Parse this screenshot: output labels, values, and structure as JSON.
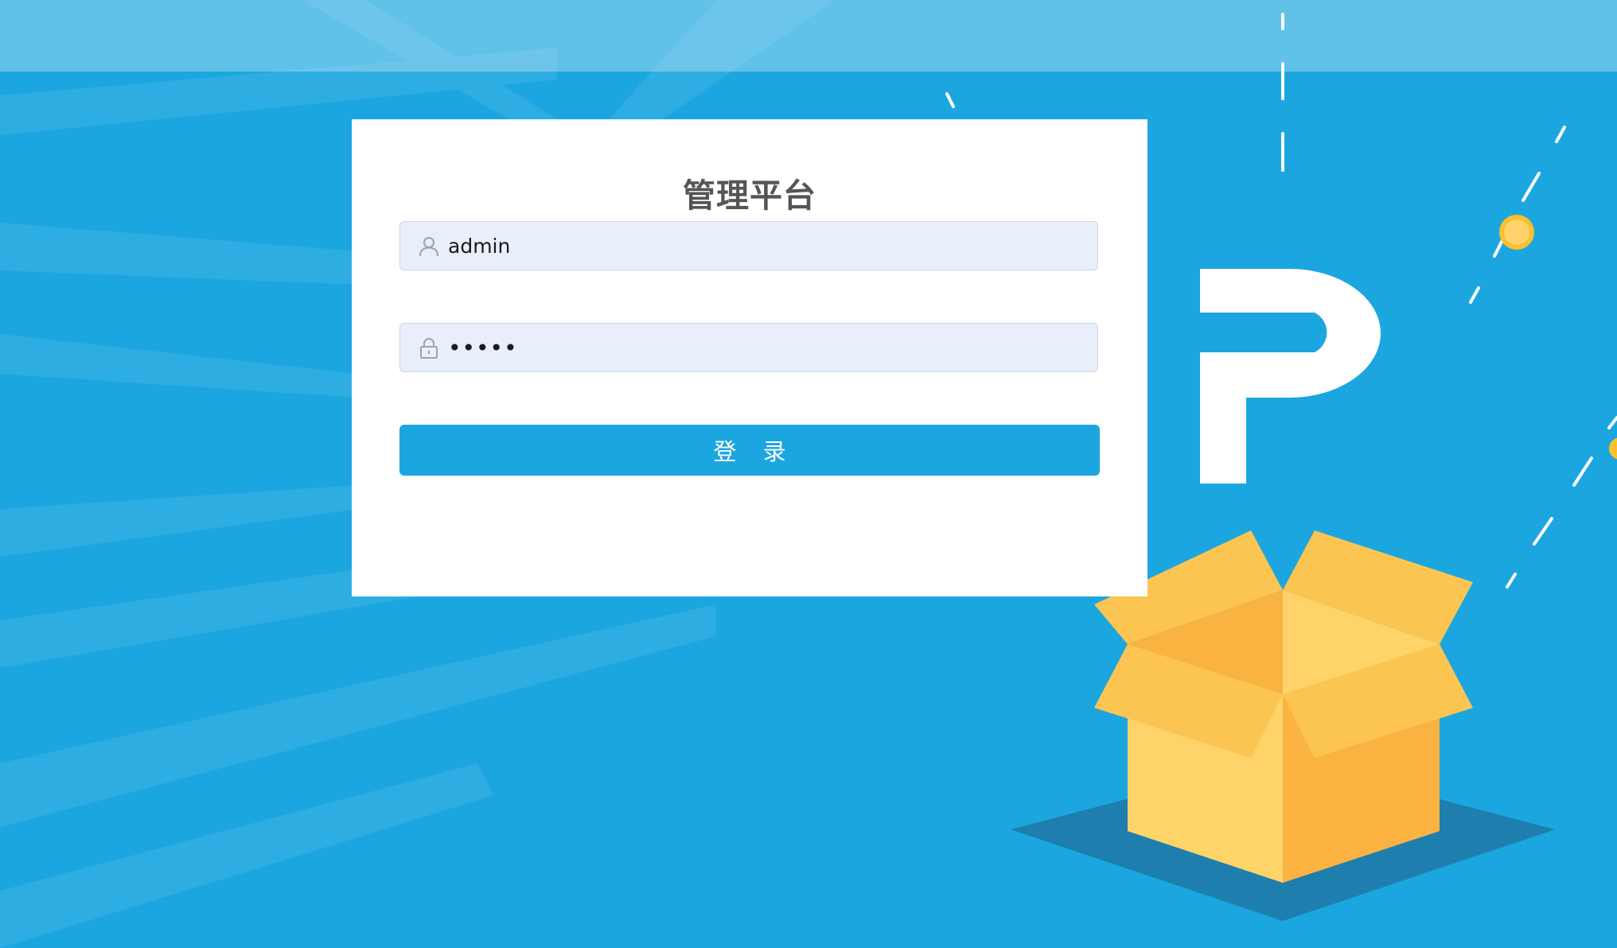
{
  "page": {
    "title": "管理平台"
  },
  "form": {
    "username": {
      "value": "admin",
      "icon": "user-icon"
    },
    "password": {
      "value": "•••••",
      "icon": "lock-icon"
    },
    "submit_label": "登 录"
  },
  "colors": {
    "background": "#1ca6e0",
    "button": "#1ca6e0",
    "input_bg": "#e8effb",
    "title": "#555555",
    "box_light": "#fdd36a",
    "box_mid": "#fcc552",
    "box_dark": "#fab340",
    "coin": "#fbc02d"
  }
}
